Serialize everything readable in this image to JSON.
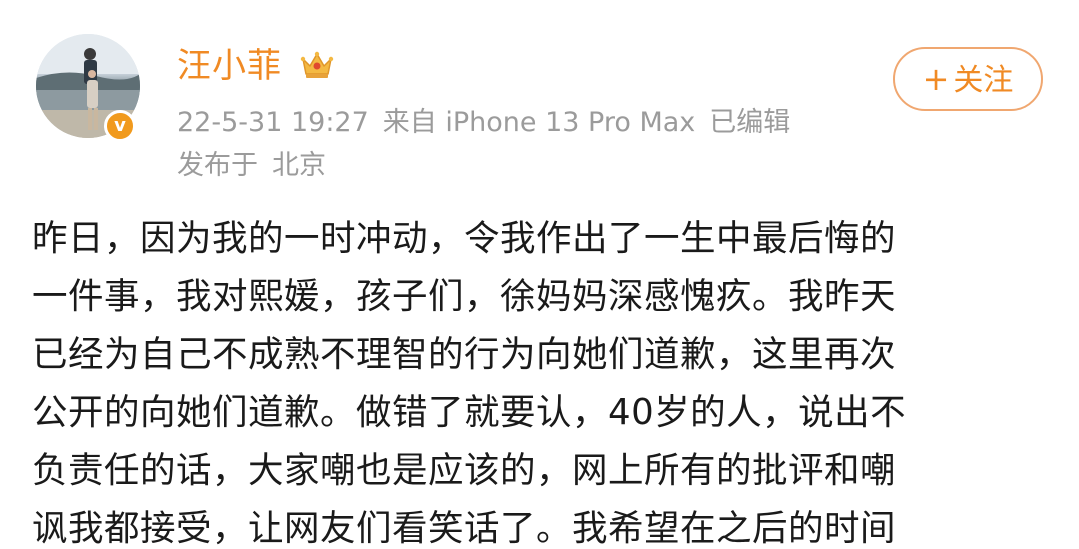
{
  "post": {
    "author": {
      "name": "汪小菲",
      "avatar_icon": "avatar-photo-icon",
      "badge_icon": "crown-icon",
      "verified_symbol": "v"
    },
    "meta": {
      "datetime": "22-5-31 19:27",
      "source": "来自 iPhone 13 Pro Max",
      "edited": "已编辑",
      "location_prefix": "发布于",
      "location": "北京"
    },
    "follow_button": {
      "plus": "+",
      "label": "关注"
    },
    "content_lines": [
      "昨日，因为我的一时冲动，令我作出了一生中最后悔的",
      "一件事，我对熙媛，孩子们，徐妈妈深感愧疚。我昨天",
      "已经为自己不成熟不理智的行为向她们道歉，这里再次",
      "公开的向她们道歉。做错了就要认，40岁的人，说出不",
      "负责任的话，大家嘲也是应该的，网上所有的批评和嘲",
      "讽我都接受，让网友们看笑话了。我希望在之后的时间"
    ]
  },
  "colors": {
    "accent": "#f08a24",
    "meta_text": "#9b9b9b",
    "body_text": "#1a1a1a",
    "verified_badge": "#f19a1d",
    "follow_border": "#f0a770"
  }
}
